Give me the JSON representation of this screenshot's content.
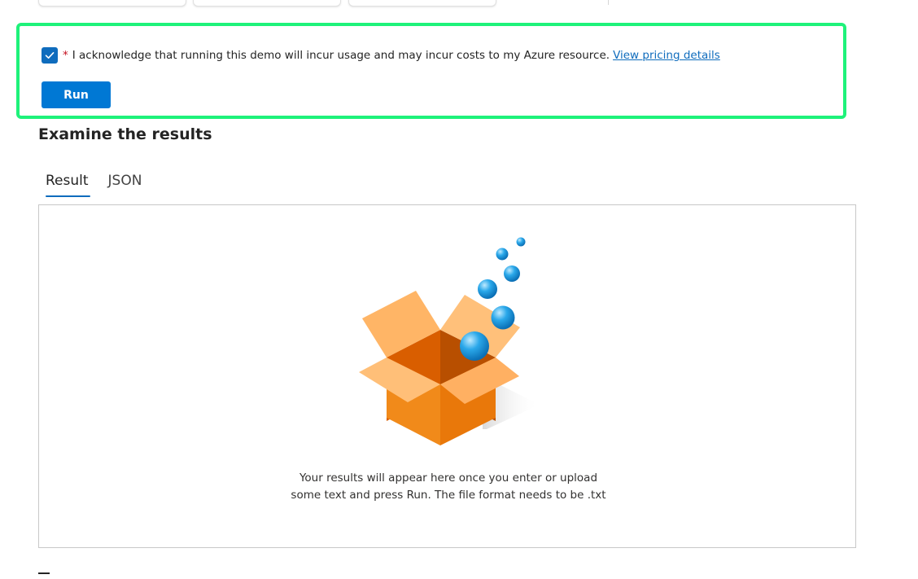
{
  "acknowledgement": {
    "checked": true,
    "required_mark": "*",
    "text": "I acknowledge that running this demo will incur usage and may incur costs to my Azure resource.",
    "link_text": "View pricing details"
  },
  "run_button_label": "Run",
  "results_section": {
    "title": "Examine the results",
    "tabs": [
      {
        "label": "Result",
        "active": true
      },
      {
        "label": "JSON",
        "active": false
      }
    ],
    "empty_message": "Your results will appear here once you enter or upload some text and press Run. The file format needs to be .txt"
  },
  "colors": {
    "highlight_border": "#1ef27a",
    "primary_button": "#0078d4",
    "link": "#0f6cbd",
    "checkbox": "#0f6cbd",
    "box_orange": "#f08a24",
    "bubble_blue": "#1e9be0"
  },
  "icons": [
    "checkmark-icon",
    "empty-box-illustration"
  ]
}
